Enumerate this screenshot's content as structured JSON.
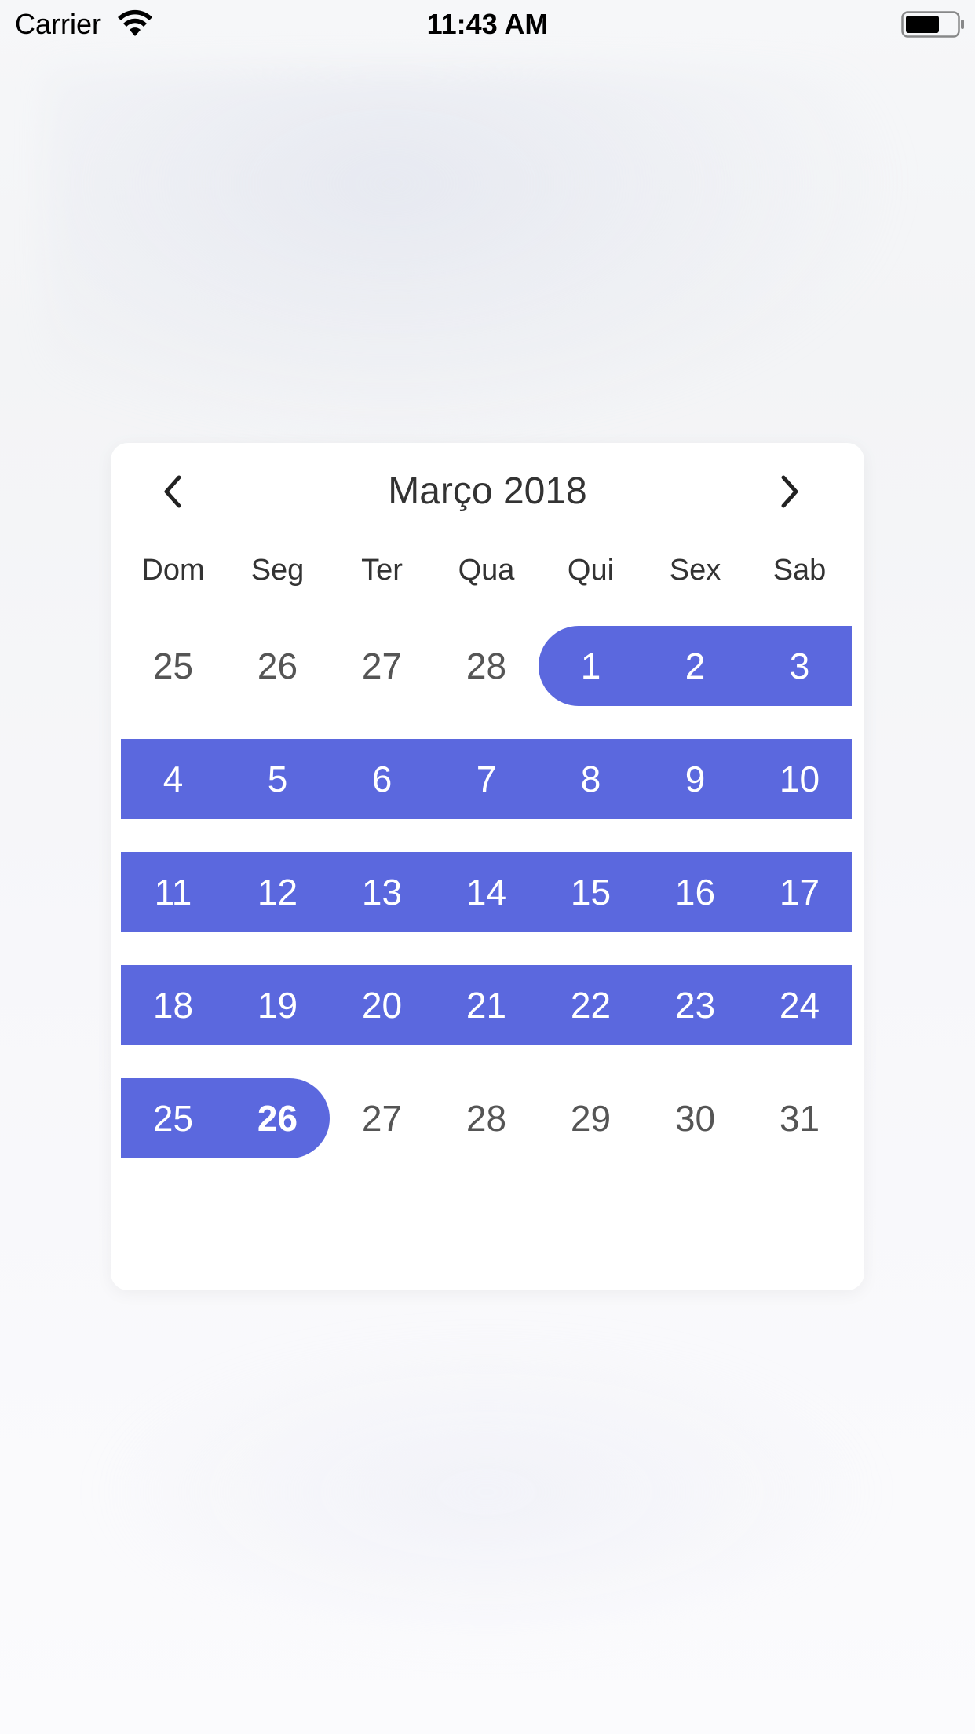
{
  "status_bar": {
    "carrier": "Carrier",
    "time": "11:43 AM",
    "wifi_icon": "wifi-icon",
    "battery_icon": "battery-icon"
  },
  "calendar": {
    "month_title": "Março 2018",
    "prev_icon": "chevron-left-icon",
    "next_icon": "chevron-right-icon",
    "weekdays": [
      "Dom",
      "Seg",
      "Ter",
      "Qua",
      "Qui",
      "Sex",
      "Sab"
    ],
    "accent_color": "#5b68de",
    "selected_range": {
      "start": "1",
      "end": "26"
    },
    "weeks": [
      [
        "25",
        "26",
        "27",
        "28",
        "1",
        "2",
        "3"
      ],
      [
        "4",
        "5",
        "6",
        "7",
        "8",
        "9",
        "10"
      ],
      [
        "11",
        "12",
        "13",
        "14",
        "15",
        "16",
        "17"
      ],
      [
        "18",
        "19",
        "20",
        "21",
        "22",
        "23",
        "24"
      ],
      [
        "25",
        "26",
        "27",
        "28",
        "29",
        "30",
        "31"
      ]
    ]
  }
}
